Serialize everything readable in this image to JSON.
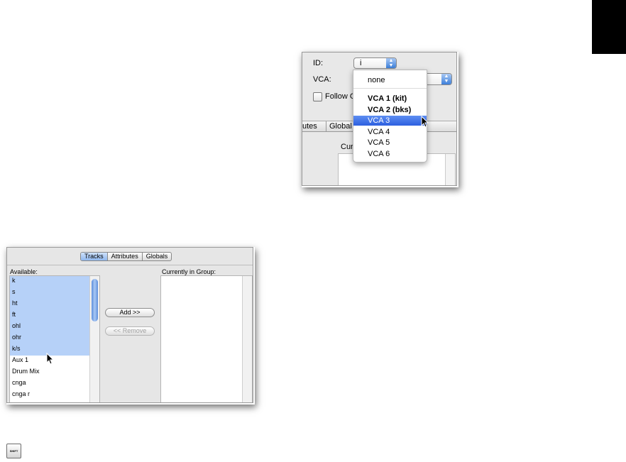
{
  "top_panel": {
    "id_label": "ID:",
    "id_value": "i",
    "vca_label": "VCA:",
    "follow_label": "Follow G",
    "tab_partial_1": "utes",
    "tab_partial_2": "Global",
    "currently_partial": "Curr"
  },
  "vca_menu": {
    "items": [
      "none",
      "VCA 1 (kit)",
      "VCA 2 (bks)",
      "VCA 3",
      "VCA 4",
      "VCA 5",
      "VCA 6"
    ],
    "selected": "VCA 3"
  },
  "bottom_panel": {
    "tabs": [
      "Tracks",
      "Attributes",
      "Globals"
    ],
    "active_tab": "Tracks",
    "available_label": "Available:",
    "current_label": "Currently in Group:",
    "available_items": [
      "k",
      "s",
      "ht",
      "ft",
      "ohl",
      "ohr",
      "k/s",
      "Aux 1",
      "Drum Mix",
      "cnga",
      "cnga r"
    ],
    "add_button": "Add >>",
    "remove_button": "<< Remove"
  },
  "shift_key": {
    "label": "SHIFT"
  },
  "colors": {
    "highlight": "#b6d1f8",
    "menu_selection": "#2d5fdf",
    "scroll_thumb": "#5c8edc"
  }
}
